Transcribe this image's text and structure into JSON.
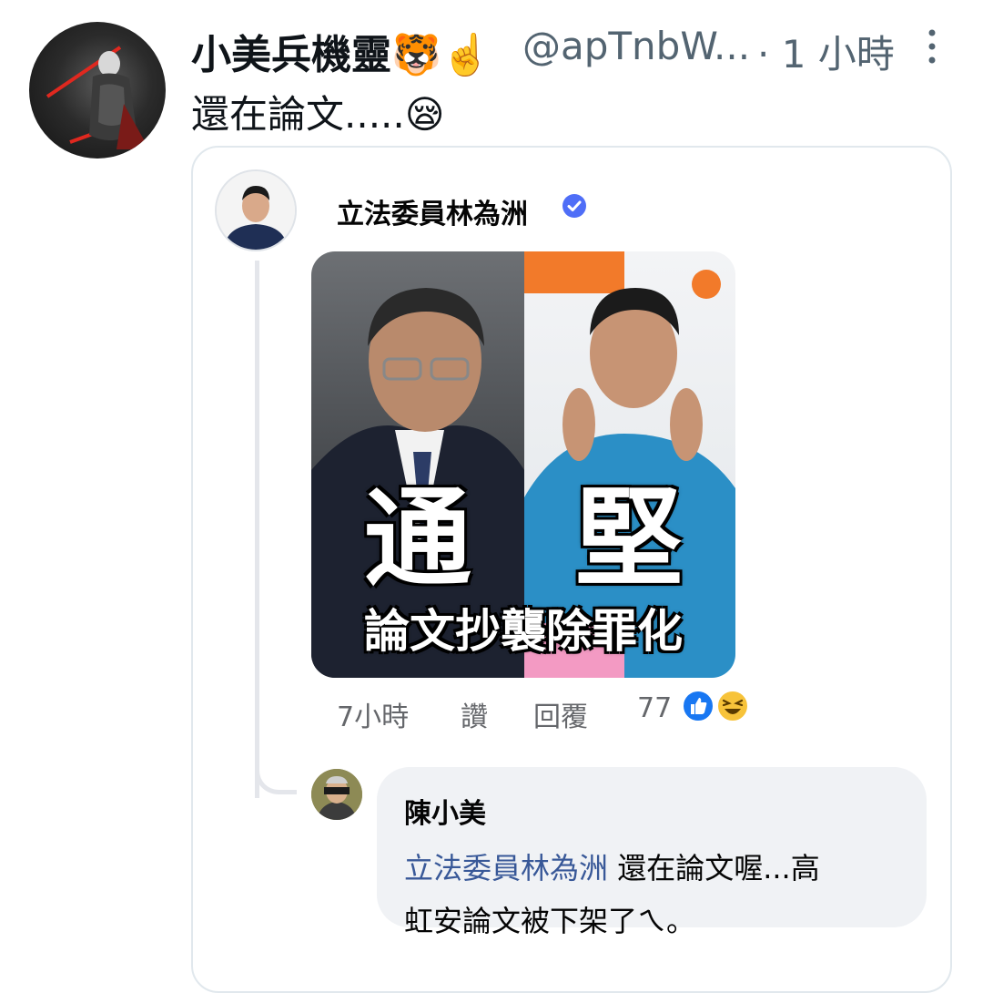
{
  "tweet": {
    "display_name": "小美兵機靈🐯☝️",
    "handle": "@apTnbW...",
    "time": "· 1 小時",
    "text": "還在論文.....😪"
  },
  "quoted_post": {
    "author": "立法委員林為洲",
    "image_left_char": "通",
    "image_right_char": "堅",
    "image_caption": "論文抄襲除罪化",
    "actions": {
      "time": "7小時",
      "like": "讚",
      "reply": "回覆",
      "reaction_count": "77"
    },
    "reactions": [
      "like-icon",
      "haha-icon"
    ]
  },
  "reply": {
    "name": "陳小美",
    "mention": "立法委員林為洲",
    "text_line1": "還在論文喔...高",
    "text_line2": "虹安論文被下架了ㄟ。"
  },
  "colors": {
    "handle_gray": "#536471",
    "mention_blue": "#385898",
    "bubble_bg": "#f0f2f5",
    "verified_blue": "#4f6ef7",
    "like_blue": "#1877f2",
    "haha_yellow": "#f7c33a"
  }
}
